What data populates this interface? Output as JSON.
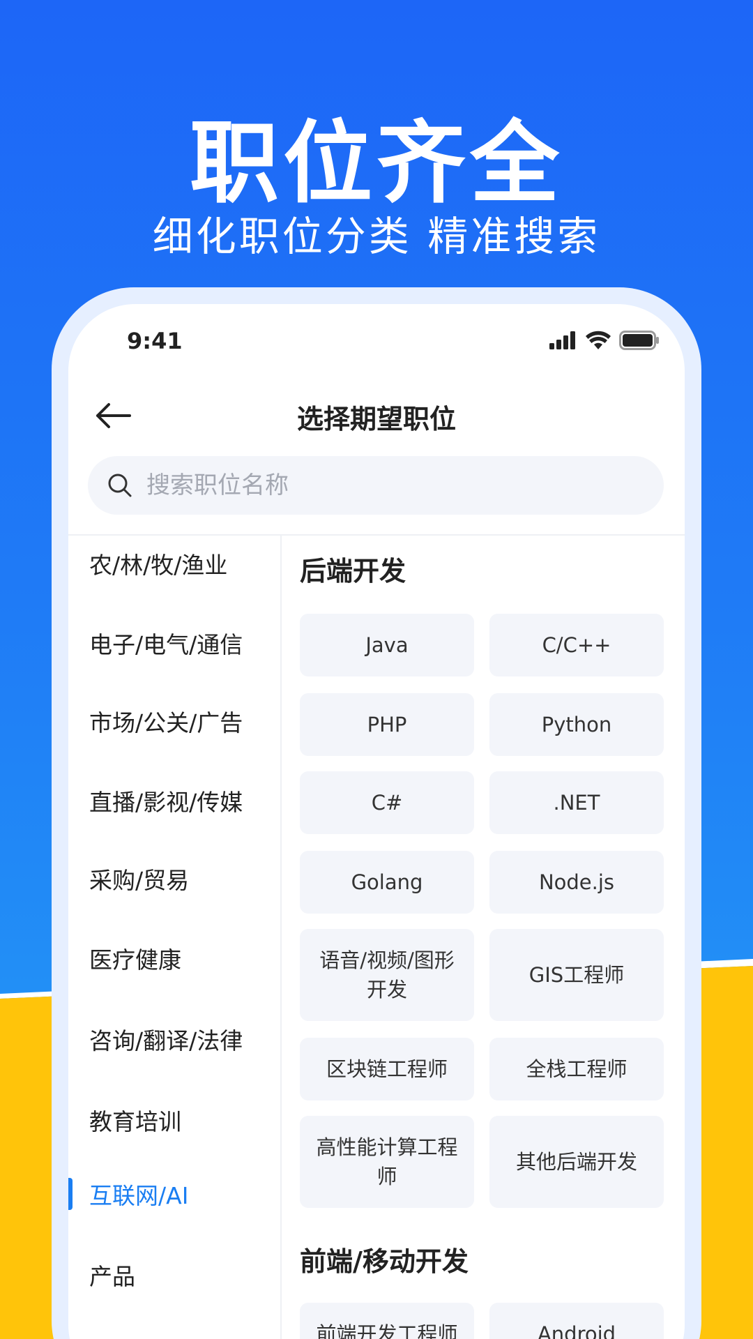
{
  "promo": {
    "title": "职位齐全",
    "subtitle": "细化职位分类 精准搜索"
  },
  "status_bar": {
    "time": "9:41",
    "icons": [
      "signal-icon",
      "wifi-icon",
      "battery-icon"
    ]
  },
  "nav": {
    "title": "选择期望职位",
    "back_icon": "arrow-left-icon"
  },
  "search": {
    "placeholder": "搜索职位名称",
    "value": ""
  },
  "sidebar": {
    "items": [
      {
        "label": "农/林/牧/渔业",
        "active": false
      },
      {
        "label": "电子/电气/通信",
        "active": false
      },
      {
        "label": "市场/公关/广告",
        "active": false
      },
      {
        "label": "直播/影视/传媒",
        "active": false
      },
      {
        "label": "采购/贸易",
        "active": false
      },
      {
        "label": "医疗健康",
        "active": false
      },
      {
        "label": "咨询/翻译/法律",
        "active": false
      },
      {
        "label": "教育培训",
        "active": false
      },
      {
        "label": "互联网/AI",
        "active": true
      },
      {
        "label": "产品",
        "active": false
      }
    ]
  },
  "sections": [
    {
      "title": "后端开发",
      "chips": [
        "Java",
        "C/C++",
        "PHP",
        "Python",
        "C#",
        ".NET",
        "Golang",
        "Node.js",
        "语音/视频/图形开发",
        "GIS工程师",
        "区块链工程师",
        "全栈工程师",
        "高性能计算工程师",
        "其他后端开发"
      ]
    },
    {
      "title": "前端/移动开发",
      "chips": [
        "前端开发工程师",
        "Android"
      ]
    }
  ],
  "colors": {
    "accent": "#1a7ef2",
    "promo_blue": "#1d66f7",
    "promo_yellow": "#ffc40a",
    "chip_bg": "#f3f5fa"
  }
}
